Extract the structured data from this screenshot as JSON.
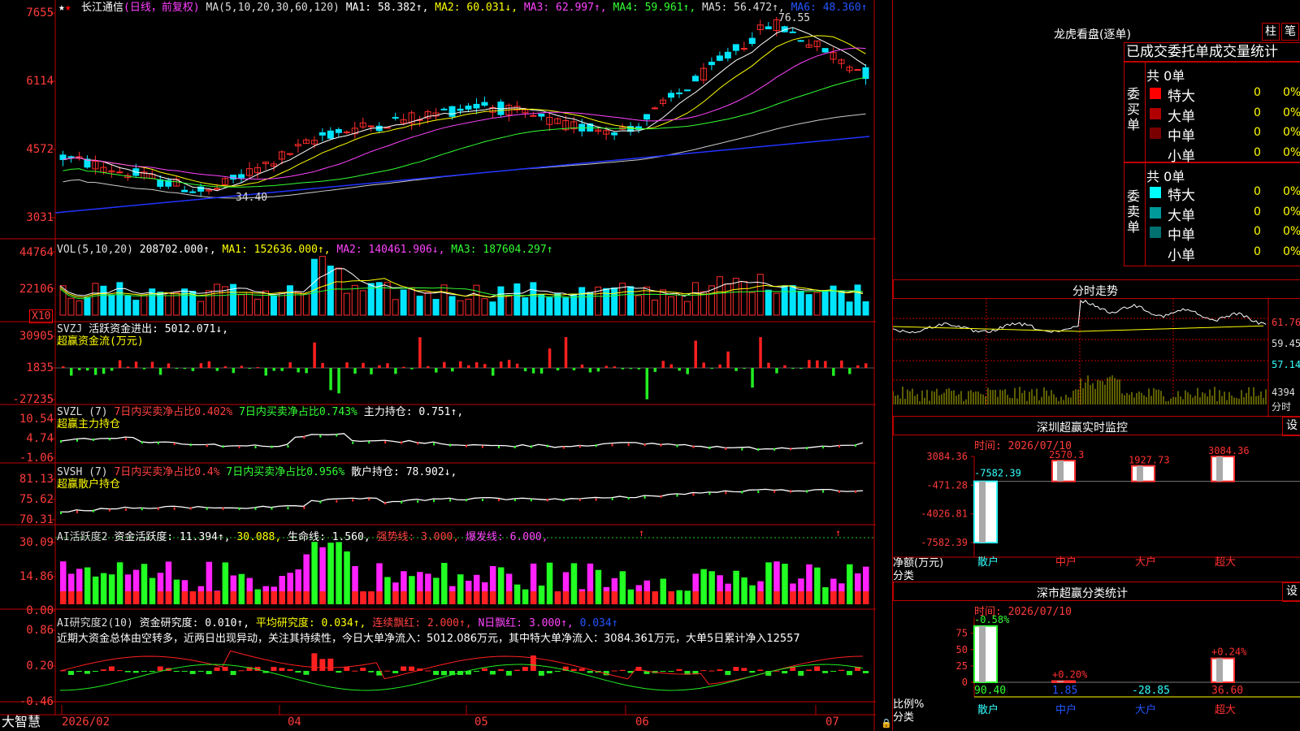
{
  "main": {
    "axis": [
      "7655",
      "6114",
      "4572",
      "3031"
    ],
    "stock_name": "长江通信",
    "period": "(日线，前复权)",
    "ma_header": "MA(5,10,20,30,60,120)",
    "ma1": "MA1: 58.382↑,",
    "ma2": "MA2: 60.031↓,",
    "ma3": "MA3: 62.997↑,",
    "ma4": "MA4: 59.961↑,",
    "ma5": "MA5: 56.472↑,",
    "ma6": "MA6: 48.360↑",
    "high_label": "76.55",
    "low_label": "34.40"
  },
  "volume": {
    "axis": [
      "44764",
      "22106"
    ],
    "unit": "X10",
    "header": "VOL(5,10,20)",
    "value": "208702.000↑,",
    "ma1": "MA1: 152636.000↑,",
    "ma2": "MA2: 140461.906↓,",
    "ma3": "MA3: 187604.297↑"
  },
  "svzj": {
    "axis": [
      "30905",
      "1835",
      "-27235"
    ],
    "header": "SVZJ",
    "desc": "活跃资金进出: 5012.071↓,",
    "title": "超赢资金流(万元)"
  },
  "svzl": {
    "axis": [
      "10.54",
      "4.74",
      "-1.06"
    ],
    "header": "SVZL (7)",
    "seg1": "7日内买卖净占比0.402%",
    "seg2": "7日内买卖净占比0.743%",
    "seg3": "主力持仓: 0.751↑,",
    "title": "超赢主力持仓"
  },
  "svsh": {
    "axis": [
      "81.13",
      "75.62",
      "70.31"
    ],
    "header": "SVSH (7)",
    "seg1": "7日内买卖净占比0.4%",
    "seg2": "7日内买卖净占比0.956%",
    "seg3": "散户持仓: 78.902↓,",
    "title": "超赢散户持仓"
  },
  "active": {
    "axis": [
      "30.09",
      "14.86",
      "0.00"
    ],
    "header": "AI活跃度2",
    "seg1": "资金活跃度: 11.394↑,",
    "seg2": "30.088,",
    "seg3": "生命线: 1.560,",
    "seg4": "强势线: 3.000,",
    "seg5": "爆发线: 6.000,"
  },
  "research": {
    "axis": [
      "0.86",
      "0.20",
      "-0.46"
    ],
    "header": "AI研究度2(10)",
    "seg1": "资金研究度: 0.010↑,",
    "seg2": "平均研究度: 0.034↑,",
    "seg3": "连续飘红: 2.000↑,",
    "seg4": "N日飘红: 3.000↑,",
    "seg5": "0.034↑",
    "note": "近期大资金总体由空转多，近两日出现异动，关注其持续性，今日大单净流入：5012.086万元，其中特大单净流入：3084.361万元，大单5日累计净入12557"
  },
  "bottom": {
    "brand": "大智慧",
    "dates": [
      "2026/02",
      "04",
      "05",
      "06",
      "07"
    ]
  },
  "lhb": {
    "title": "龙虎看盘(逐单)",
    "btn_bar": "柱",
    "btn_tick": "笔",
    "tabs": "已成交委托单成交量统计",
    "buy_label": "委买单",
    "sell_label": "委卖单",
    "buy_total": "共 0单",
    "sell_total": "共 0单",
    "buy_rows": [
      {
        "name": "特大",
        "count": "0",
        "pct": "0%",
        "color": "#ff0000"
      },
      {
        "name": "大单",
        "count": "0",
        "pct": "0%",
        "color": "#b00000"
      },
      {
        "name": "中单",
        "count": "0",
        "pct": "0%",
        "color": "#7a0000"
      },
      {
        "name": "小单",
        "count": "0",
        "pct": "0%",
        "color": ""
      }
    ],
    "sell_rows": [
      {
        "name": "特大",
        "count": "0",
        "pct": "0%",
        "color": "#00ffff"
      },
      {
        "name": "大单",
        "count": "0",
        "pct": "0%",
        "color": "#009a9a"
      },
      {
        "name": "中单",
        "count": "0",
        "pct": "0%",
        "color": "#007070"
      },
      {
        "name": "小单",
        "count": "0",
        "pct": "0%",
        "color": ""
      }
    ]
  },
  "intraday": {
    "title": "分时走势",
    "axis": [
      "61.76",
      "59.45",
      "57.14",
      "4394"
    ],
    "unit": "分时"
  },
  "sz_monitor": {
    "title": "深圳超赢实时监控",
    "btn": "设",
    "time": "时间: 2026/07/10",
    "axis": [
      "3084.36",
      "-471.28",
      "-4026.81",
      "-7582.39"
    ],
    "bar_labels": [
      "-7582.39",
      "2570.3",
      "1927.73",
      "3084.36"
    ],
    "y_title": "净额(万元)",
    "x_title": "分类",
    "cats": [
      "散户",
      "中户",
      "大户",
      "超大"
    ],
    "values": [
      -7582.39,
      2570.3,
      1927.73,
      3084.36
    ]
  },
  "classify": {
    "title": "深市超赢分类统计",
    "btn": "设",
    "time": "时间: 2026/07/10",
    "axis": [
      "75",
      "50",
      "25",
      "0"
    ],
    "bar_labels": [
      "-0.58%",
      "+0.20%",
      "+0.24%"
    ],
    "y_title": "比例%",
    "x_title": "分类",
    "cats": [
      "散户",
      "中户",
      "大户",
      "超大"
    ],
    "vals": [
      "90.40",
      "1.85",
      "-28.85",
      "36.60"
    ],
    "values": [
      90.4,
      1.85,
      -28.85,
      36.6
    ]
  }
}
